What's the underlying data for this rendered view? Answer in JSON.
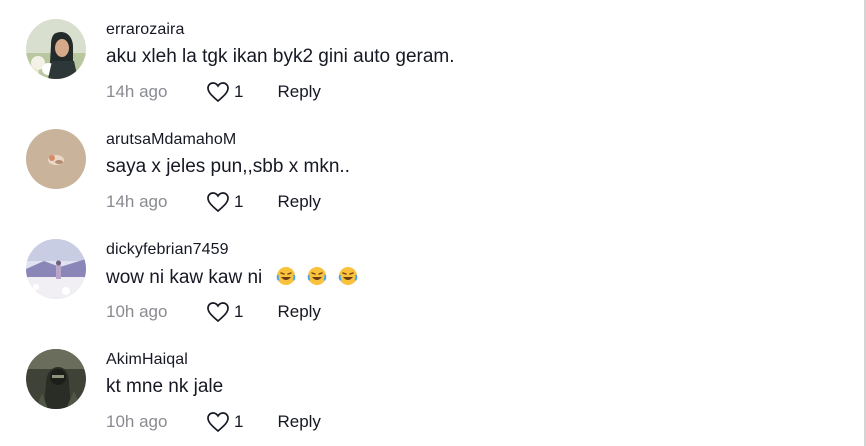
{
  "comments": [
    {
      "username": "errarozaira",
      "text": "aku xleh la tgk ikan byk2 gini auto geram.",
      "time": "14h ago",
      "likes": "1",
      "reply": "Reply"
    },
    {
      "username": "arutsaMdamahoM",
      "text": "saya x jeles pun,,sbb x mkn..",
      "time": "14h ago",
      "likes": "1",
      "reply": "Reply"
    },
    {
      "username": "dickyfebrian7459",
      "text": "wow ni kaw kaw ni",
      "emoji": [
        "laughing-crying-emoji",
        "laughing-crying-emoji",
        "laughing-crying-emoji"
      ],
      "time": "10h ago",
      "likes": "1",
      "reply": "Reply"
    },
    {
      "username": "AkimHaiqal",
      "text": "kt mne nk jale",
      "time": "10h ago",
      "likes": "1",
      "reply": "Reply"
    }
  ],
  "icons": {
    "like": "heart-outline-icon"
  },
  "colors": {
    "text": "#161823",
    "muted": "#8a8b91"
  }
}
